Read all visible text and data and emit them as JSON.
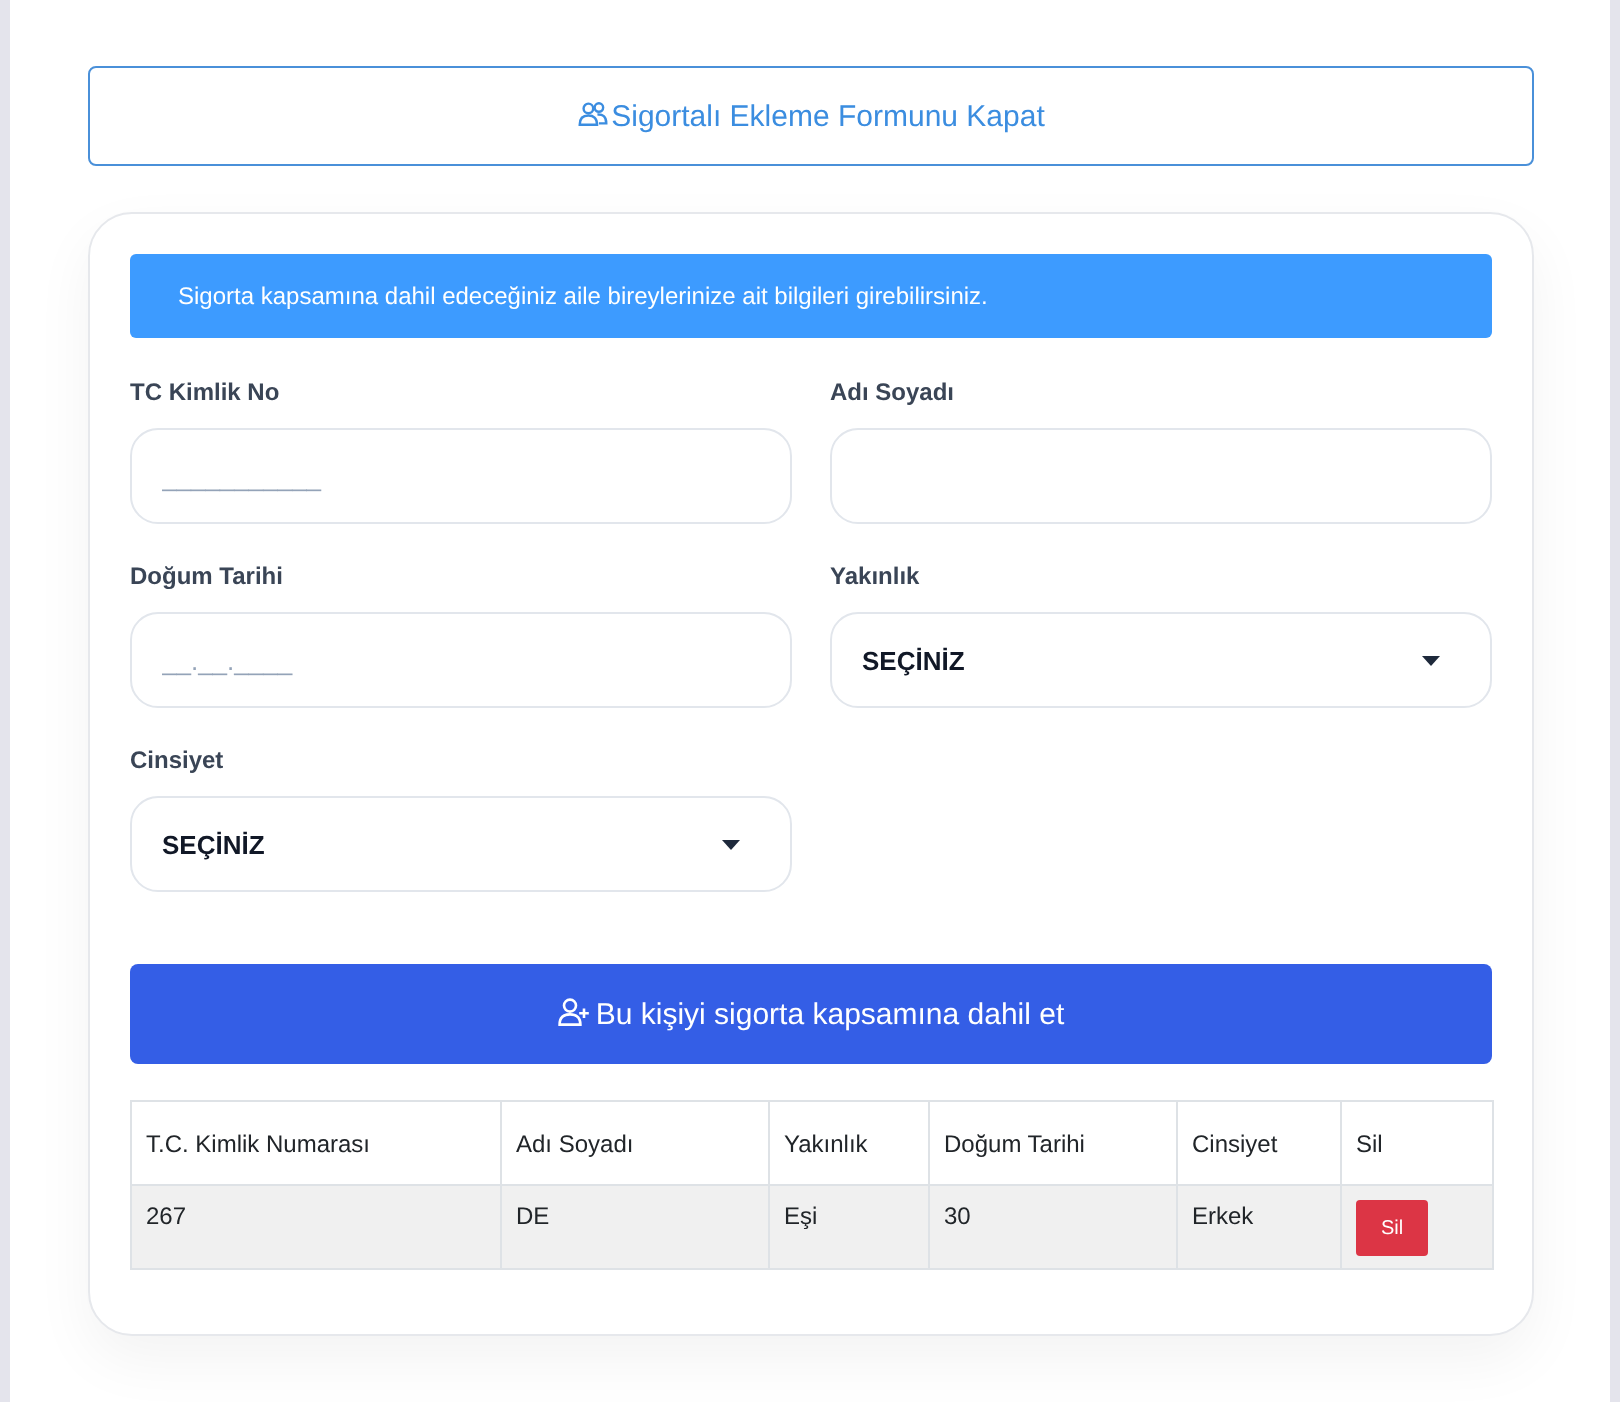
{
  "toggle_button": {
    "label": "Sigortalı Ekleme Formunu Kapat"
  },
  "form": {
    "info": "Sigorta kapsamına dahil edeceğiniz aile bireylerinize ait bilgileri girebilirsiniz.",
    "fields": [
      {
        "kind": "input",
        "label": "TC Kimlik No",
        "placeholder": "___________"
      },
      {
        "kind": "input",
        "label": "Adı Soyadı"
      },
      {
        "kind": "input",
        "label": "Doğum Tarihi",
        "placeholder": "__.__.____"
      },
      {
        "kind": "select",
        "label": "Yakınlık",
        "value": "SEÇİNİZ"
      },
      {
        "kind": "select",
        "label": "Cinsiyet",
        "value": "SEÇİNİZ"
      }
    ],
    "submit_button": {
      "label": "Bu kişiyi sigorta kapsamına dahil et"
    }
  },
  "table": {
    "columns": [
      "T.C. Kimlik Numarası",
      "Adı Soyadı",
      "Yakınlık",
      "Doğum Tarihi",
      "Cinsiyet",
      "Sil"
    ],
    "rows": [
      {
        "cells": [
          "267",
          "DE",
          "Eşi",
          "30",
          "Erkek"
        ],
        "delete_label": "Sil"
      }
    ]
  }
}
